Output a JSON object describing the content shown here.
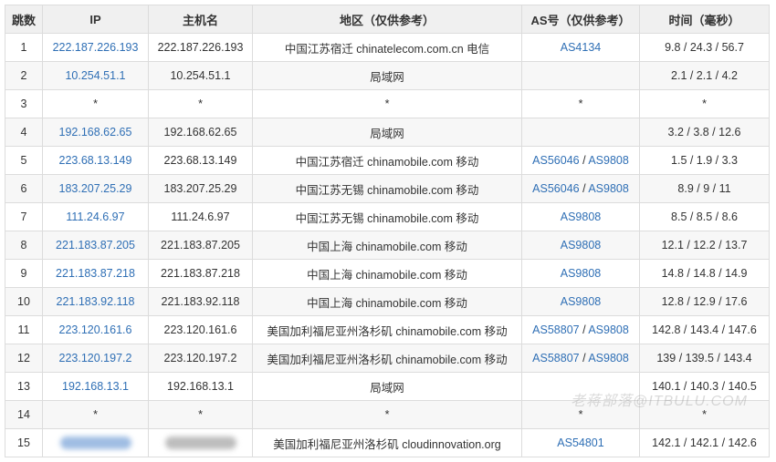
{
  "table": {
    "headers": [
      "跳数",
      "IP",
      "主机名",
      "地区（仅供参考）",
      "AS号（仅供参考）",
      "时间（毫秒）"
    ],
    "rows": [
      {
        "hop": "1",
        "ip": "222.187.226.193",
        "host": "222.187.226.193",
        "region": "中国江苏宿迁 chinatelecom.com.cn 电信",
        "as": [
          "AS4134"
        ],
        "time": "9.8 / 24.3 / 56.7"
      },
      {
        "hop": "2",
        "ip": "10.254.51.1",
        "host": "10.254.51.1",
        "region": "局域网",
        "as": [],
        "time": "2.1 / 2.1 / 4.2"
      },
      {
        "hop": "3",
        "ip": "*",
        "host": "*",
        "region": "*",
        "as_text": "*",
        "as": [],
        "time": "*"
      },
      {
        "hop": "4",
        "ip": "192.168.62.65",
        "host": "192.168.62.65",
        "region": "局域网",
        "as": [],
        "time": "3.2 / 3.8 / 12.6"
      },
      {
        "hop": "5",
        "ip": "223.68.13.149",
        "host": "223.68.13.149",
        "region": "中国江苏宿迁 chinamobile.com 移动",
        "as": [
          "AS56046",
          "AS9808"
        ],
        "time": "1.5 / 1.9 / 3.3"
      },
      {
        "hop": "6",
        "ip": "183.207.25.29",
        "host": "183.207.25.29",
        "region": "中国江苏无锡 chinamobile.com 移动",
        "as": [
          "AS56046",
          "AS9808"
        ],
        "time": "8.9 / 9 / 11"
      },
      {
        "hop": "7",
        "ip": "111.24.6.97",
        "host": "111.24.6.97",
        "region": "中国江苏无锡 chinamobile.com 移动",
        "as": [
          "AS9808"
        ],
        "time": "8.5 / 8.5 / 8.6"
      },
      {
        "hop": "8",
        "ip": "221.183.87.205",
        "host": "221.183.87.205",
        "region": "中国上海 chinamobile.com 移动",
        "as": [
          "AS9808"
        ],
        "time": "12.1 / 12.2 / 13.7"
      },
      {
        "hop": "9",
        "ip": "221.183.87.218",
        "host": "221.183.87.218",
        "region": "中国上海 chinamobile.com 移动",
        "as": [
          "AS9808"
        ],
        "time": "14.8 / 14.8 / 14.9"
      },
      {
        "hop": "10",
        "ip": "221.183.92.118",
        "host": "221.183.92.118",
        "region": "中国上海 chinamobile.com 移动",
        "as": [
          "AS9808"
        ],
        "time": "12.8 / 12.9 / 17.6"
      },
      {
        "hop": "11",
        "ip": "223.120.161.6",
        "host": "223.120.161.6",
        "region": "美国加利福尼亚州洛杉矶 chinamobile.com 移动",
        "as": [
          "AS58807",
          "AS9808"
        ],
        "time": "142.8 / 143.4 / 147.6"
      },
      {
        "hop": "12",
        "ip": "223.120.197.2",
        "host": "223.120.197.2",
        "region": "美国加利福尼亚州洛杉矶 chinamobile.com 移动",
        "as": [
          "AS58807",
          "AS9808"
        ],
        "time": "139 / 139.5 / 143.4"
      },
      {
        "hop": "13",
        "ip": "192.168.13.1",
        "host": "192.168.13.1",
        "region": "局域网",
        "as": [],
        "time": "140.1 / 140.3 / 140.5"
      },
      {
        "hop": "14",
        "ip": "*",
        "host": "*",
        "region": "*",
        "as_text": "*",
        "as": [],
        "time": "*"
      },
      {
        "hop": "15",
        "ip": "",
        "host": "",
        "region": "美国加利福尼亚州洛杉矶 cloudinnovation.org",
        "as": [
          "AS54801"
        ],
        "time": "142.1 / 142.1 / 142.6",
        "redacted": true
      }
    ]
  },
  "watermark": "老蒋部落@ITBULU.COM",
  "colors": {
    "link": "#2f6fb5",
    "header_bg": "#f0f0f0",
    "stripe_bg": "#f7f7f7",
    "border": "#dcdcdc"
  }
}
